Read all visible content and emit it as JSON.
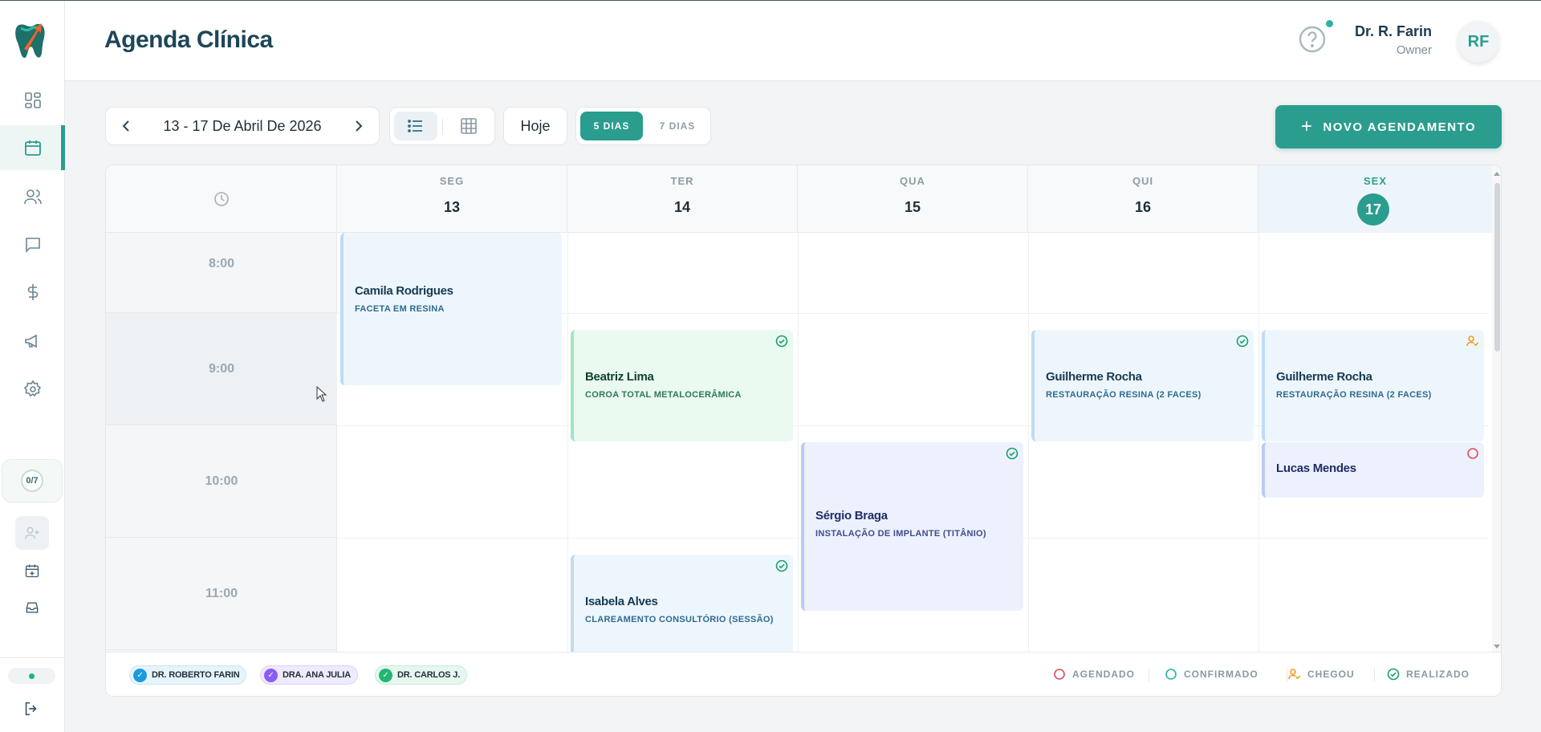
{
  "header": {
    "title": "Agenda Clínica",
    "user_name": "Dr. R. Farin",
    "user_role": "Owner",
    "avatar_initials": "RF"
  },
  "sidebar": {
    "items": [
      {
        "icon": "dashboard-icon"
      },
      {
        "icon": "calendar-icon",
        "active": true
      },
      {
        "icon": "users-icon"
      },
      {
        "icon": "chat-icon"
      },
      {
        "icon": "dollar-icon"
      },
      {
        "icon": "megaphone-icon"
      },
      {
        "icon": "gear-icon"
      }
    ],
    "badge": "0/7"
  },
  "toolbar": {
    "date_range": "13 - 17 De Abril De 2026",
    "today_label": "Hoje",
    "five_days": "5 DIAS",
    "seven_days": "7 DIAS",
    "new_button": "NOVO AGENDAMENTO"
  },
  "calendar": {
    "days": [
      {
        "dow": "SEG",
        "num": "13"
      },
      {
        "dow": "TER",
        "num": "14"
      },
      {
        "dow": "QUA",
        "num": "15"
      },
      {
        "dow": "QUI",
        "num": "16"
      },
      {
        "dow": "SEX",
        "num": "17",
        "today": true
      }
    ],
    "hours": [
      "8:00",
      "9:00",
      "10:00",
      "11:00"
    ],
    "appointments": [
      {
        "patient": "Camila Rodrigues",
        "procedure": "FACETA EM RESINA",
        "day": "SEG"
      },
      {
        "patient": "Beatriz Lima",
        "procedure": "COROA TOTAL METALOCERÂMICA",
        "day": "TER",
        "status": "realizado"
      },
      {
        "patient": "Guilherme Rocha",
        "procedure": "RESTAURAÇÃO RESINA (2 FACES)",
        "day": "QUI",
        "status": "realizado"
      },
      {
        "patient": "Guilherme Rocha",
        "procedure": "RESTAURAÇÃO RESINA (2 FACES)",
        "day": "SEX",
        "status": "chegou"
      },
      {
        "patient": "Sérgio Braga",
        "procedure": "INSTALAÇÃO DE IMPLANTE (TITÂNIO)",
        "day": "QUA",
        "status": "realizado"
      },
      {
        "patient": "Lucas Mendes",
        "procedure": "",
        "day": "SEX",
        "status": "agendado"
      },
      {
        "patient": "Isabela Alves",
        "procedure": "CLAREAMENTO CONSULTÓRIO (SESSÃO)",
        "day": "TER",
        "status": "realizado"
      }
    ]
  },
  "legend": {
    "doctors": [
      {
        "name": "DR. ROBERTO FARIN",
        "color": "#1a9be0"
      },
      {
        "name": "DRA. ANA JULIA",
        "color": "#8b5cf6"
      },
      {
        "name": "DR. CARLOS J.",
        "color": "#22b573"
      }
    ],
    "statuses": [
      {
        "label": "AGENDADO",
        "color": "#e34b5a"
      },
      {
        "label": "CONFIRMADO",
        "color": "#2ab39e"
      },
      {
        "label": "CHEGOU",
        "color": "#f29d1c"
      },
      {
        "label": "REALIZADO",
        "color": "#1b9e6b"
      }
    ]
  }
}
